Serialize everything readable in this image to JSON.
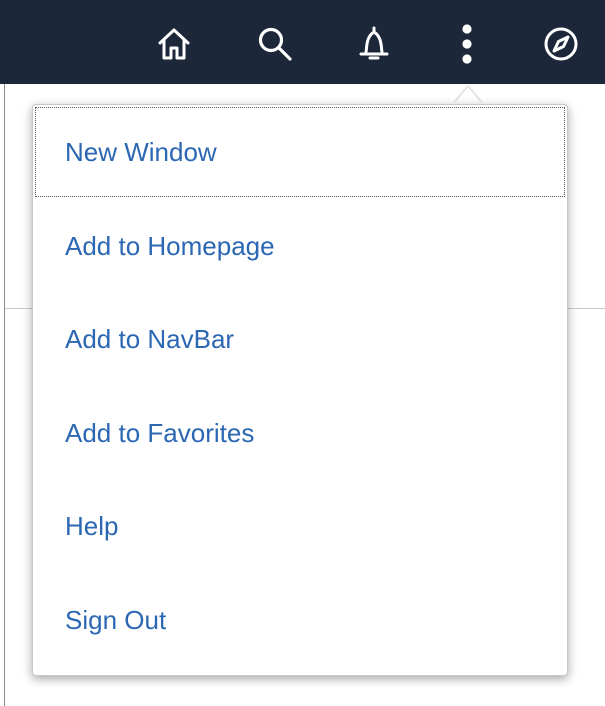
{
  "topbar": {
    "background": "#1c2839",
    "icons": [
      {
        "name": "home-icon"
      },
      {
        "name": "search-icon"
      },
      {
        "name": "notifications-bell-icon"
      },
      {
        "name": "actions-menu-icon"
      },
      {
        "name": "navbar-compass-icon"
      }
    ]
  },
  "actions_menu": {
    "link_color": "#2b67b3",
    "focused_item": "New Window",
    "items": [
      {
        "label": "New Window"
      },
      {
        "label": "Add to Homepage"
      },
      {
        "label": "Add to NavBar"
      },
      {
        "label": "Add to Favorites"
      },
      {
        "label": "Help"
      },
      {
        "label": "Sign Out"
      }
    ]
  }
}
